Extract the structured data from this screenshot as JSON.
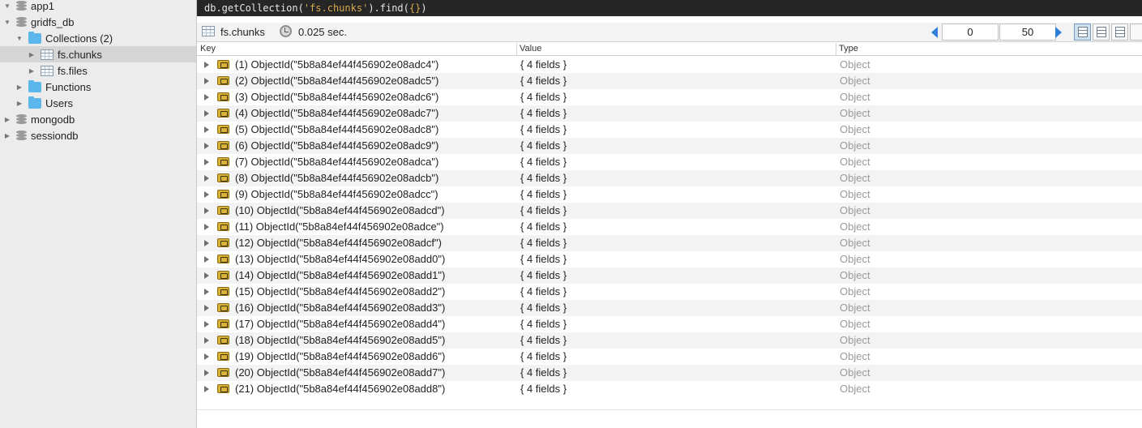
{
  "sidebar": {
    "items": [
      {
        "label": "app1",
        "icon": "database-icon",
        "level": 0,
        "expanded": true
      },
      {
        "label": "gridfs_db",
        "icon": "database-icon",
        "level": 0,
        "expanded": true
      },
      {
        "label": "Collections (2)",
        "icon": "folder-icon",
        "level": 1,
        "expanded": true
      },
      {
        "label": "fs.chunks",
        "icon": "collection-icon",
        "level": 2,
        "expanded": false,
        "selected": true
      },
      {
        "label": "fs.files",
        "icon": "collection-icon",
        "level": 2,
        "expanded": false
      },
      {
        "label": "Functions",
        "icon": "folder-icon",
        "level": 1,
        "expanded": false
      },
      {
        "label": "Users",
        "icon": "folder-icon",
        "level": 1,
        "expanded": false
      },
      {
        "label": "mongodb",
        "icon": "database-icon",
        "level": 0,
        "expanded": false
      },
      {
        "label": "sessiondb",
        "icon": "database-icon",
        "level": 0,
        "expanded": false
      }
    ]
  },
  "query": {
    "prefix": "db.getCollection(",
    "collection_arg": "'fs.chunks'",
    "middle": ").find(",
    "filter_arg": "{}",
    "suffix": ")"
  },
  "toolbar": {
    "collection": "fs.chunks",
    "time": "0.025 sec.",
    "skip": "0",
    "limit": "50"
  },
  "grid": {
    "columns": [
      "Key",
      "Value",
      "Type"
    ],
    "rows": [
      {
        "key": "(1) ObjectId(\"5b8a84ef44f456902e08adc4\")",
        "value": "{ 4 fields }",
        "type": "Object"
      },
      {
        "key": "(2) ObjectId(\"5b8a84ef44f456902e08adc5\")",
        "value": "{ 4 fields }",
        "type": "Object"
      },
      {
        "key": "(3) ObjectId(\"5b8a84ef44f456902e08adc6\")",
        "value": "{ 4 fields }",
        "type": "Object"
      },
      {
        "key": "(4) ObjectId(\"5b8a84ef44f456902e08adc7\")",
        "value": "{ 4 fields }",
        "type": "Object"
      },
      {
        "key": "(5) ObjectId(\"5b8a84ef44f456902e08adc8\")",
        "value": "{ 4 fields }",
        "type": "Object"
      },
      {
        "key": "(6) ObjectId(\"5b8a84ef44f456902e08adc9\")",
        "value": "{ 4 fields }",
        "type": "Object"
      },
      {
        "key": "(7) ObjectId(\"5b8a84ef44f456902e08adca\")",
        "value": "{ 4 fields }",
        "type": "Object"
      },
      {
        "key": "(8) ObjectId(\"5b8a84ef44f456902e08adcb\")",
        "value": "{ 4 fields }",
        "type": "Object"
      },
      {
        "key": "(9) ObjectId(\"5b8a84ef44f456902e08adcc\")",
        "value": "{ 4 fields }",
        "type": "Object"
      },
      {
        "key": "(10) ObjectId(\"5b8a84ef44f456902e08adcd\")",
        "value": "{ 4 fields }",
        "type": "Object"
      },
      {
        "key": "(11) ObjectId(\"5b8a84ef44f456902e08adce\")",
        "value": "{ 4 fields }",
        "type": "Object"
      },
      {
        "key": "(12) ObjectId(\"5b8a84ef44f456902e08adcf\")",
        "value": "{ 4 fields }",
        "type": "Object"
      },
      {
        "key": "(13) ObjectId(\"5b8a84ef44f456902e08add0\")",
        "value": "{ 4 fields }",
        "type": "Object"
      },
      {
        "key": "(14) ObjectId(\"5b8a84ef44f456902e08add1\")",
        "value": "{ 4 fields }",
        "type": "Object"
      },
      {
        "key": "(15) ObjectId(\"5b8a84ef44f456902e08add2\")",
        "value": "{ 4 fields }",
        "type": "Object"
      },
      {
        "key": "(16) ObjectId(\"5b8a84ef44f456902e08add3\")",
        "value": "{ 4 fields }",
        "type": "Object"
      },
      {
        "key": "(17) ObjectId(\"5b8a84ef44f456902e08add4\")",
        "value": "{ 4 fields }",
        "type": "Object"
      },
      {
        "key": "(18) ObjectId(\"5b8a84ef44f456902e08add5\")",
        "value": "{ 4 fields }",
        "type": "Object"
      },
      {
        "key": "(19) ObjectId(\"5b8a84ef44f456902e08add6\")",
        "value": "{ 4 fields }",
        "type": "Object"
      },
      {
        "key": "(20) ObjectId(\"5b8a84ef44f456902e08add7\")",
        "value": "{ 4 fields }",
        "type": "Object"
      },
      {
        "key": "(21) ObjectId(\"5b8a84ef44f456902e08add8\")",
        "value": "{ 4 fields }",
        "type": "Object"
      }
    ]
  }
}
